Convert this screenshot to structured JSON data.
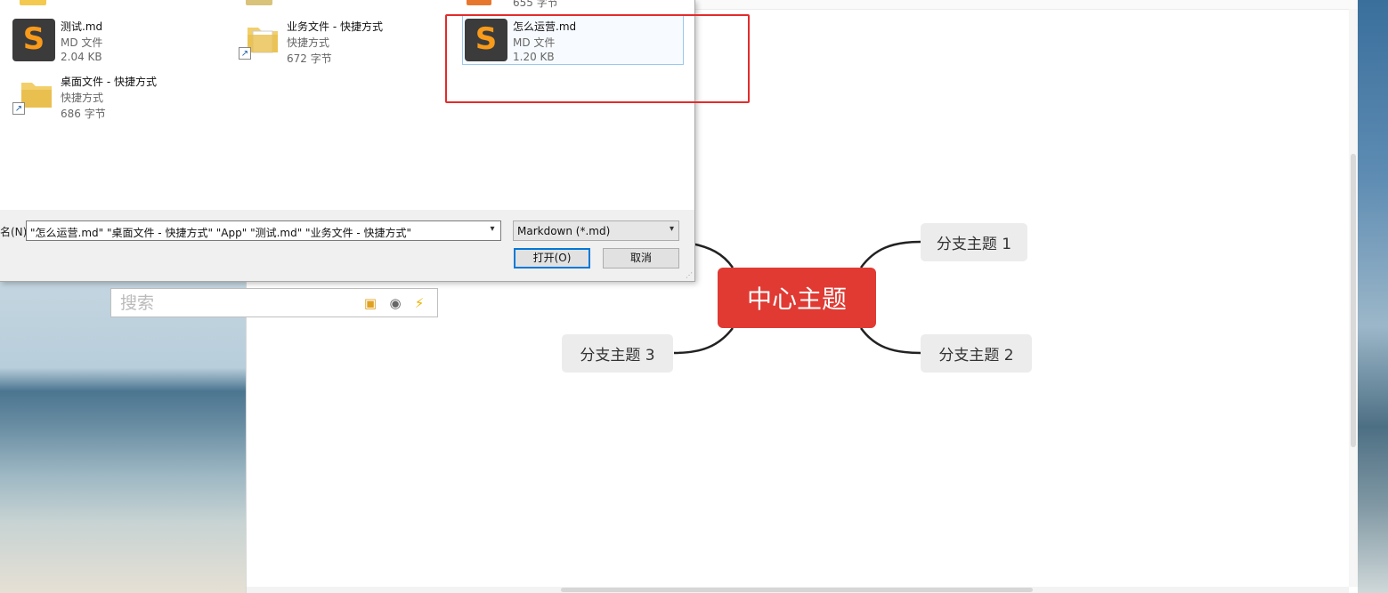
{
  "dialog": {
    "files": [
      {
        "name": "测试.md",
        "type": "MD 文件",
        "size": "2.04 KB",
        "icon": "sublime-text-icon"
      },
      {
        "name": "业务文件 - 快捷方式",
        "type": "快捷方式",
        "size": "672 字节",
        "icon": "folder-shortcut-icon"
      },
      {
        "name": "怎么运营.md",
        "type": "MD 文件",
        "size": "1.20 KB",
        "icon": "sublime-text-icon"
      },
      {
        "name": "桌面文件 - 快捷方式",
        "type": "快捷方式",
        "size": "686 字节",
        "icon": "folder-shortcut-icon"
      }
    ],
    "partial_top_size": "655 字节",
    "filename_label": "名(N):",
    "filename_value": "\"怎么运营.md\" \"桌面文件 - 快捷方式\" \"App\" \"测试.md\" \"业务文件 - 快捷方式\"",
    "file_type": "Markdown (*.md)",
    "open_button": "打开(O)",
    "cancel_button": "取消"
  },
  "search": {
    "placeholder": "搜索"
  },
  "mindmap": {
    "center": "中心主题",
    "branches": [
      "分支主题 1",
      "分支主题 2",
      "分支主题 3"
    ]
  },
  "colors": {
    "center_node": "#e03a33",
    "branch_node": "#ececec",
    "highlight_box": "#e42b2b",
    "sublime_orange": "#f89a1a"
  }
}
